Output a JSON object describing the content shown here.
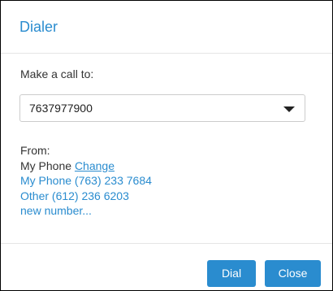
{
  "dialog": {
    "title": "Dialer"
  },
  "call": {
    "label": "Make a call to:",
    "selected_number": "7637977900"
  },
  "from": {
    "label": "From:",
    "current": "My Phone",
    "change_label": "Change",
    "options": [
      "My Phone (763) 233 7684",
      "Other (612) 236 6203",
      "new number..."
    ]
  },
  "buttons": {
    "dial_label": "Dial",
    "close_label": "Close"
  },
  "colors": {
    "accent": "#2a8ccf",
    "text": "#333333",
    "border": "#cccccc"
  },
  "icons": {
    "select_caret": "caret-down-icon"
  }
}
